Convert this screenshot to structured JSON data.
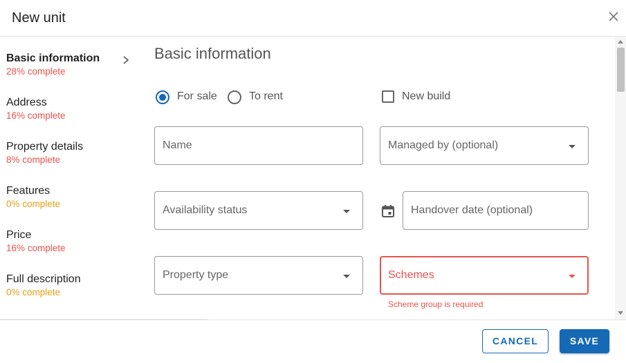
{
  "dialog": {
    "title": "New unit"
  },
  "sidebar": {
    "items": [
      {
        "label": "Basic information",
        "progress": "28% complete",
        "status": "red",
        "active": true
      },
      {
        "label": "Address",
        "progress": "16% complete",
        "status": "red",
        "active": false
      },
      {
        "label": "Property details",
        "progress": "8% complete",
        "status": "red",
        "active": false
      },
      {
        "label": "Features",
        "progress": "0% complete",
        "status": "amber",
        "active": false
      },
      {
        "label": "Price",
        "progress": "16% complete",
        "status": "red",
        "active": false
      },
      {
        "label": "Full description",
        "progress": "0% complete",
        "status": "amber",
        "active": false
      }
    ]
  },
  "form": {
    "heading": "Basic information",
    "listing_type": {
      "options": [
        "For sale",
        "To rent"
      ],
      "selected": "For sale"
    },
    "new_build": {
      "label": "New build",
      "checked": false
    },
    "fields": {
      "name": {
        "placeholder": "Name"
      },
      "managed_by": {
        "placeholder": "Managed by (optional)"
      },
      "availability_status": {
        "placeholder": "Availability status"
      },
      "handover_date": {
        "placeholder": "Handover date (optional)"
      },
      "property_type": {
        "placeholder": "Property type"
      },
      "schemes": {
        "placeholder": "Schemes",
        "error": "Scheme group is required"
      }
    }
  },
  "footer": {
    "cancel_label": "CANCEL",
    "save_label": "SAVE"
  },
  "colors": {
    "primary": "#1669b5",
    "error": "#e8534b",
    "warning": "#e3a21a"
  },
  "icons": {
    "close": "close-icon",
    "nav_chevron": "chevron-right-icon",
    "calendar": "calendar-icon",
    "dropdown": "caret-down-icon"
  }
}
